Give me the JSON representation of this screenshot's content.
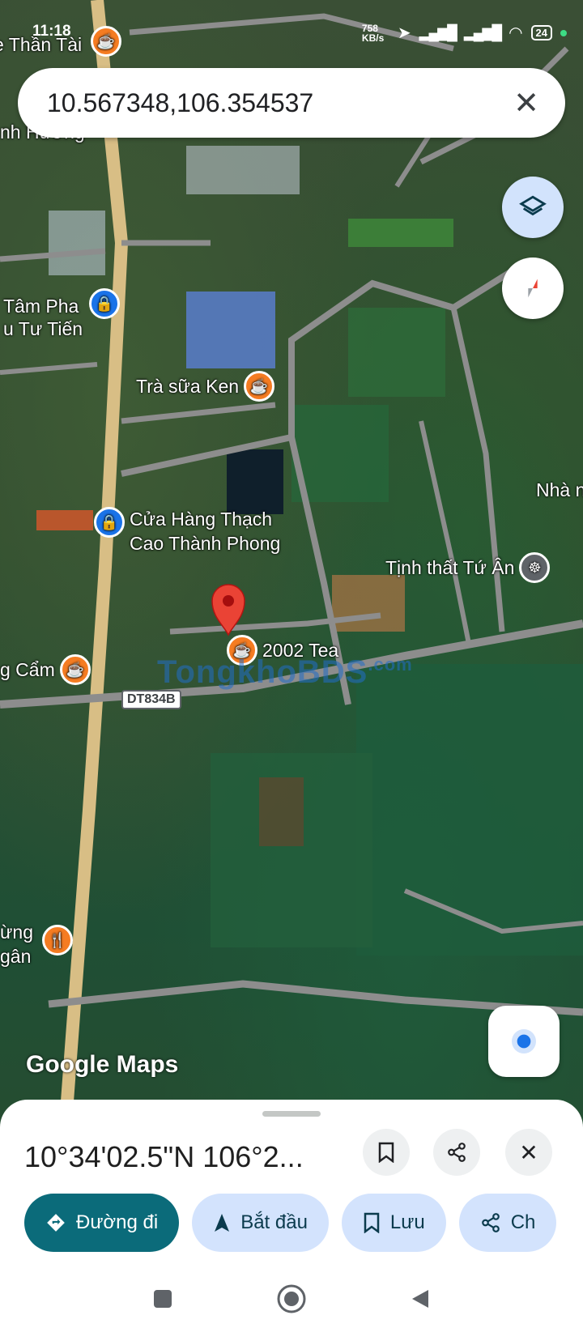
{
  "status": {
    "time": "11:18",
    "network_speed": "758 KB/s",
    "battery": "24"
  },
  "search": {
    "query": "10.567348,106.354537"
  },
  "map": {
    "labels": {
      "than_tai": "e Thần Tài",
      "nh_huong": "nh Hương",
      "tam_pha": "Tâm Pha",
      "tu_tien": "u Tư Tiến",
      "tra_sua_ken": "Trà sữa Ken",
      "thach_cao_1": "Cửa Hàng Thạch",
      "thach_cao_2": "Cao Thành Phong",
      "tinh_that": "Tịnh thất Tứ Ân",
      "nha": "Nhà n",
      "tea_2002": "2002 Tea",
      "cam": "g Cẩm",
      "dung": "ừng",
      "ngan": "gân",
      "road": "DT834B"
    },
    "logo": "Google Maps",
    "watermark": "TongkhoBDS",
    "watermark_suffix": ".com"
  },
  "place": {
    "coordinates": "10°34'02.5\"N 106°2..."
  },
  "actions": {
    "directions": "Đường đi",
    "start": "Bắt đầu",
    "save": "Lưu",
    "share": "Ch"
  },
  "colors": {
    "primary": "#0b6b7a",
    "chip": "#d3e3fd",
    "pin": "#ea4335",
    "road_main": "#e5c98a"
  }
}
